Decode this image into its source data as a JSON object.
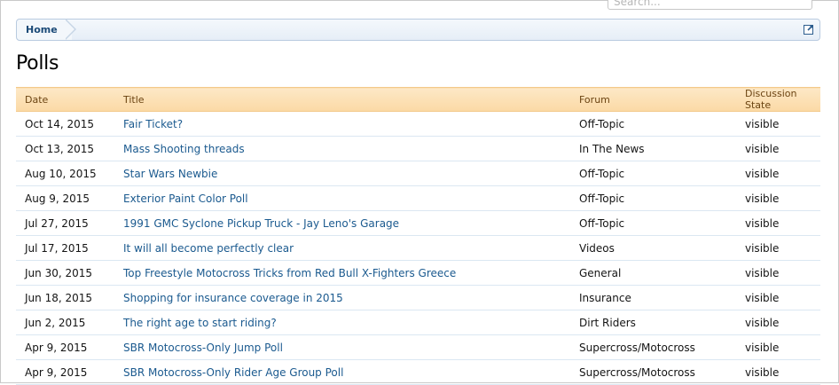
{
  "search": {
    "placeholder": "Search..."
  },
  "breadcrumb": {
    "home_label": "Home"
  },
  "page": {
    "title": "Polls"
  },
  "table": {
    "headers": [
      "Date",
      "Title",
      "Forum",
      "Discussion State"
    ],
    "rows": [
      {
        "date": "Oct 14, 2015",
        "title": "Fair Ticket?",
        "forum": "Off-Topic",
        "state": "visible"
      },
      {
        "date": "Oct 13, 2015",
        "title": "Mass Shooting threads",
        "forum": "In The News",
        "state": "visible"
      },
      {
        "date": "Aug 10, 2015",
        "title": "Star Wars Newbie",
        "forum": "Off-Topic",
        "state": "visible"
      },
      {
        "date": "Aug 9, 2015",
        "title": "Exterior Paint Color Poll",
        "forum": "Off-Topic",
        "state": "visible"
      },
      {
        "date": "Jul 27, 2015",
        "title": "1991 GMC Syclone Pickup Truck - Jay Leno's Garage",
        "forum": "Off-Topic",
        "state": "visible"
      },
      {
        "date": "Jul 17, 2015",
        "title": "It will all become perfectly clear",
        "forum": "Videos",
        "state": "visible"
      },
      {
        "date": "Jun 30, 2015",
        "title": "Top Freestyle Motocross Tricks from Red Bull X-Fighters Greece",
        "forum": "General",
        "state": "visible"
      },
      {
        "date": "Jun 18, 2015",
        "title": "Shopping for insurance coverage in 2015",
        "forum": "Insurance",
        "state": "visible"
      },
      {
        "date": "Jun 2, 2015",
        "title": "The right age to start riding?",
        "forum": "Dirt Riders",
        "state": "visible"
      },
      {
        "date": "Apr 9, 2015",
        "title": "SBR Motocross-Only Jump Poll",
        "forum": "Supercross/Motocross",
        "state": "visible"
      },
      {
        "date": "Apr 9, 2015",
        "title": "SBR Motocross-Only Rider Age Group Poll",
        "forum": "Supercross/Motocross",
        "state": "visible"
      }
    ]
  },
  "icons": {
    "jump": "external-link-icon"
  },
  "colors": {
    "link": "#1b5a8f",
    "header_bg": "#fbd9a5",
    "header_text": "#6b4412",
    "breadcrumb_text": "#1b4a77"
  }
}
